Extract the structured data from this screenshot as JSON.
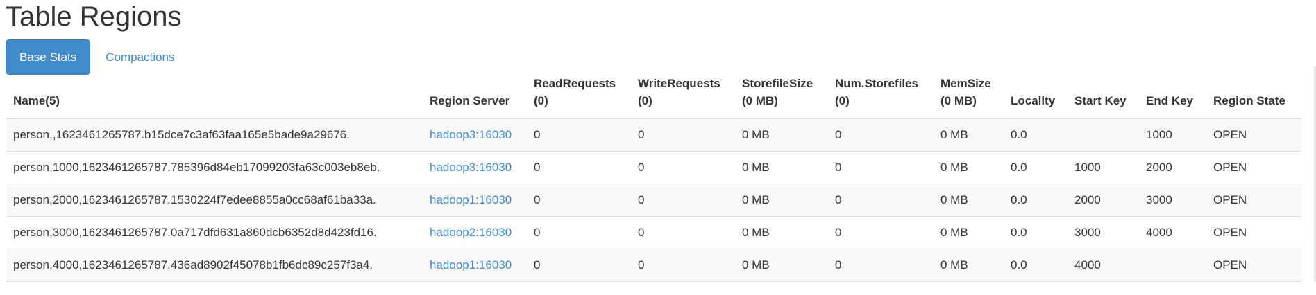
{
  "page": {
    "title": "Table Regions"
  },
  "tabs": [
    {
      "label": "Base Stats",
      "active": true
    },
    {
      "label": "Compactions",
      "active": false
    }
  ],
  "table": {
    "headers": {
      "name": [
        "Name(5)",
        ""
      ],
      "server": [
        "Region Server",
        ""
      ],
      "read": [
        "ReadRequests",
        "(0)"
      ],
      "write": [
        "WriteRequests",
        "(0)"
      ],
      "store": [
        "StorefileSize",
        "(0 MB)"
      ],
      "num": [
        "Num.Storefiles",
        "(0)"
      ],
      "mem": [
        "MemSize",
        "(0 MB)"
      ],
      "loc": [
        "Locality",
        ""
      ],
      "start": [
        "Start Key",
        ""
      ],
      "end": [
        "End Key",
        ""
      ],
      "state": [
        "Region State",
        ""
      ]
    },
    "rows": [
      {
        "name": "person,,1623461265787.b15dce7c3af63faa165e5bade9a29676.",
        "server": "hadoop3:16030",
        "read": "0",
        "write": "0",
        "store": "0 MB",
        "num": "0",
        "mem": "0 MB",
        "loc": "0.0",
        "start": "",
        "end": "1000",
        "state": "OPEN"
      },
      {
        "name": "person,1000,1623461265787.785396d84eb17099203fa63c003eb8eb.",
        "server": "hadoop3:16030",
        "read": "0",
        "write": "0",
        "store": "0 MB",
        "num": "0",
        "mem": "0 MB",
        "loc": "0.0",
        "start": "1000",
        "end": "2000",
        "state": "OPEN"
      },
      {
        "name": "person,2000,1623461265787.1530224f7edee8855a0cc68af61ba33a.",
        "server": "hadoop1:16030",
        "read": "0",
        "write": "0",
        "store": "0 MB",
        "num": "0",
        "mem": "0 MB",
        "loc": "0.0",
        "start": "2000",
        "end": "3000",
        "state": "OPEN"
      },
      {
        "name": "person,3000,1623461265787.0a717dfd631a860dcb6352d8d423fd16.",
        "server": "hadoop2:16030",
        "read": "0",
        "write": "0",
        "store": "0 MB",
        "num": "0",
        "mem": "0 MB",
        "loc": "0.0",
        "start": "3000",
        "end": "4000",
        "state": "OPEN"
      },
      {
        "name": "person,4000,1623461265787.436ad8902f45078b1fb6dc89c257f3a4.",
        "server": "hadoop1:16030",
        "read": "0",
        "write": "0",
        "store": "0 MB",
        "num": "0",
        "mem": "0 MB",
        "loc": "0.0",
        "start": "4000",
        "end": "",
        "state": "OPEN"
      }
    ]
  },
  "colors": {
    "accent": "#428bca",
    "text": "#333333",
    "stripe": "#f9f9f9",
    "border": "#dddddd"
  }
}
